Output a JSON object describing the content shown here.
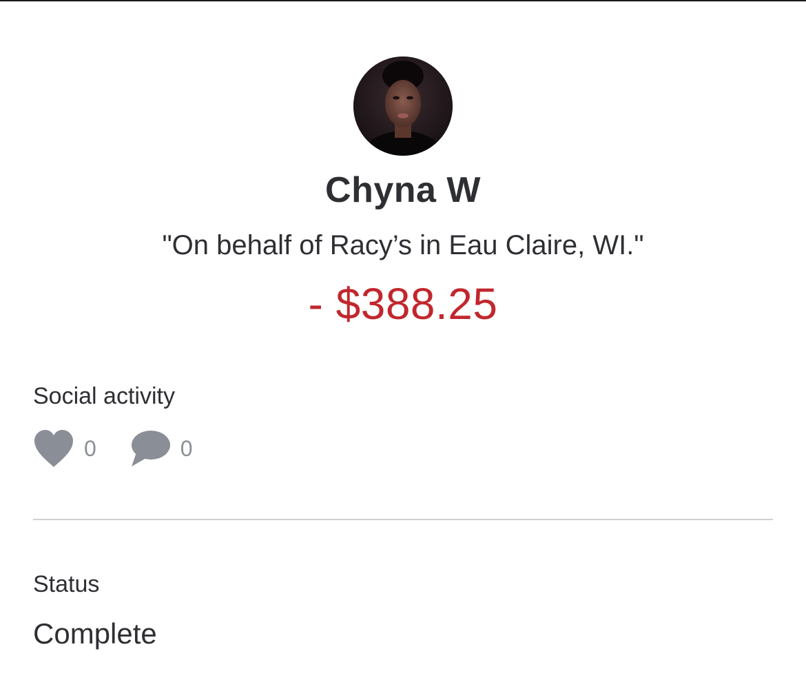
{
  "transaction": {
    "name": "Chyna W",
    "note": "\"On behalf of Racy’s in Eau Claire, WI.\"",
    "amount": "- $388.25"
  },
  "social": {
    "label": "Social activity",
    "likes": "0",
    "comments": "0",
    "icons": [
      "heart-icon",
      "comment-icon"
    ]
  },
  "status": {
    "label": "Status",
    "value": "Complete"
  },
  "colors": {
    "amount": "#c1272d",
    "icon": "#8a8e96",
    "text": "#2e2f33",
    "divider": "#cfd0d3"
  }
}
